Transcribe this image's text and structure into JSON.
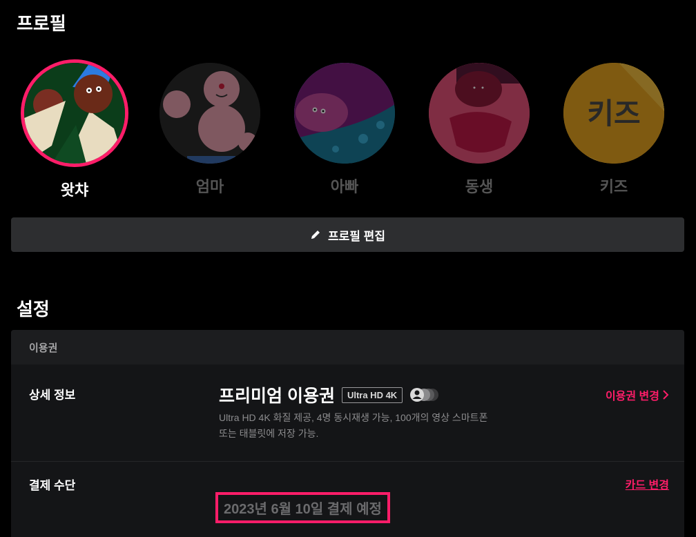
{
  "profiles_section": {
    "title": "프로필",
    "profiles": [
      {
        "name": "왓챠",
        "active": true
      },
      {
        "name": "엄마",
        "active": false
      },
      {
        "name": "아빠",
        "active": false
      },
      {
        "name": "동생",
        "active": false
      },
      {
        "name": "키즈",
        "active": false,
        "avatar_text": "키즈"
      }
    ],
    "edit_button": "프로필 편집"
  },
  "settings_section": {
    "title": "설정",
    "subscription_header": "이용권",
    "plan_row": {
      "label": "상세 정보",
      "plan_name": "프리미엄 이용권",
      "badge": "Ultra HD 4K",
      "description": "Ultra HD 4K 화질 제공, 4명 동시재생 가능, 100개의 영상 스마트폰 또는 태블릿에 저장 가능.",
      "link": "이용권 변경",
      "link_icon": "chevron-right-icon"
    },
    "payment_row": {
      "label": "결제 수단",
      "next_payment": "2023년 6월 10일 결제 예정",
      "link": "카드 변경"
    }
  },
  "colors": {
    "accent": "#ff1d69",
    "background": "#000000",
    "panel": "#141517",
    "button": "#2d2e30"
  }
}
